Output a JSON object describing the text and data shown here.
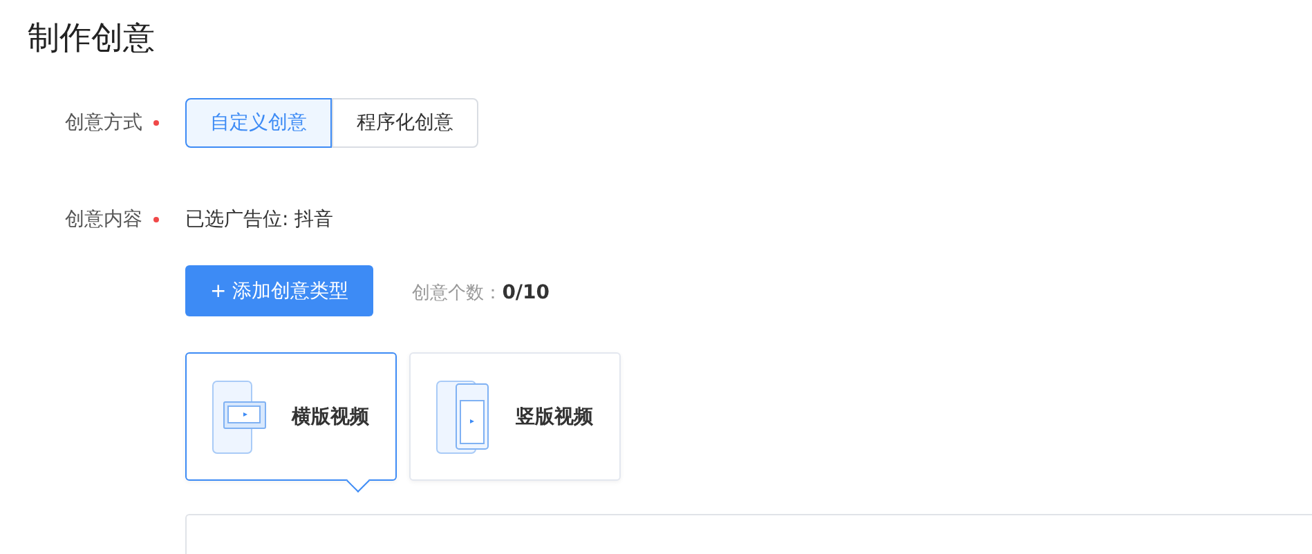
{
  "title": "制作创意",
  "mode": {
    "label": "创意方式",
    "required": true,
    "options": [
      {
        "label": "自定义创意",
        "selected": true
      },
      {
        "label": "程序化创意",
        "selected": false
      }
    ]
  },
  "content": {
    "label": "创意内容",
    "required": true,
    "placement": "已选广告位: 抖音",
    "add_button": "+ 添加创意类型",
    "count_label": "创意个数：",
    "count": "0/10",
    "types": [
      {
        "kind": "horizontal",
        "label": "横版视频",
        "selected": true
      },
      {
        "kind": "vertical",
        "label": "竖版视频",
        "selected": false
      }
    ]
  }
}
